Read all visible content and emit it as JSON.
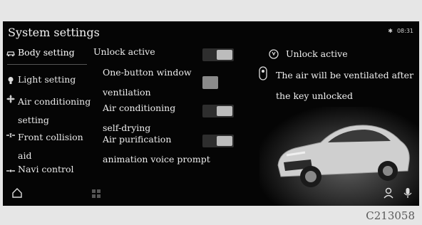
{
  "screen": {
    "title": "System settings",
    "time": "08:31"
  },
  "sidebar": {
    "items": [
      {
        "label": "Body setting"
      },
      {
        "label": "Light setting"
      },
      {
        "label": "Air conditioning setting"
      },
      {
        "label": "Front collision aid"
      },
      {
        "label": "Navi control"
      }
    ]
  },
  "options": [
    {
      "label": "Unlock active",
      "on": true
    },
    {
      "label_line1": "One-button window",
      "label_line2": "ventilation",
      "on": false
    },
    {
      "label_line1": "Air conditioning",
      "label_line2": "self-drying",
      "on": true
    },
    {
      "label_line1": "Air purification",
      "label_line2": "animation voice prompt",
      "on": true
    }
  ],
  "info_panel": {
    "heading": "Unlock active",
    "line1": "The air will be ventilated after",
    "line2": "the key unlocked"
  },
  "caption": "C213058",
  "colors": {
    "screen_bg": "#050505",
    "toggle_on": "#bcbcbc",
    "toggle_off": "#8a8a8a"
  }
}
